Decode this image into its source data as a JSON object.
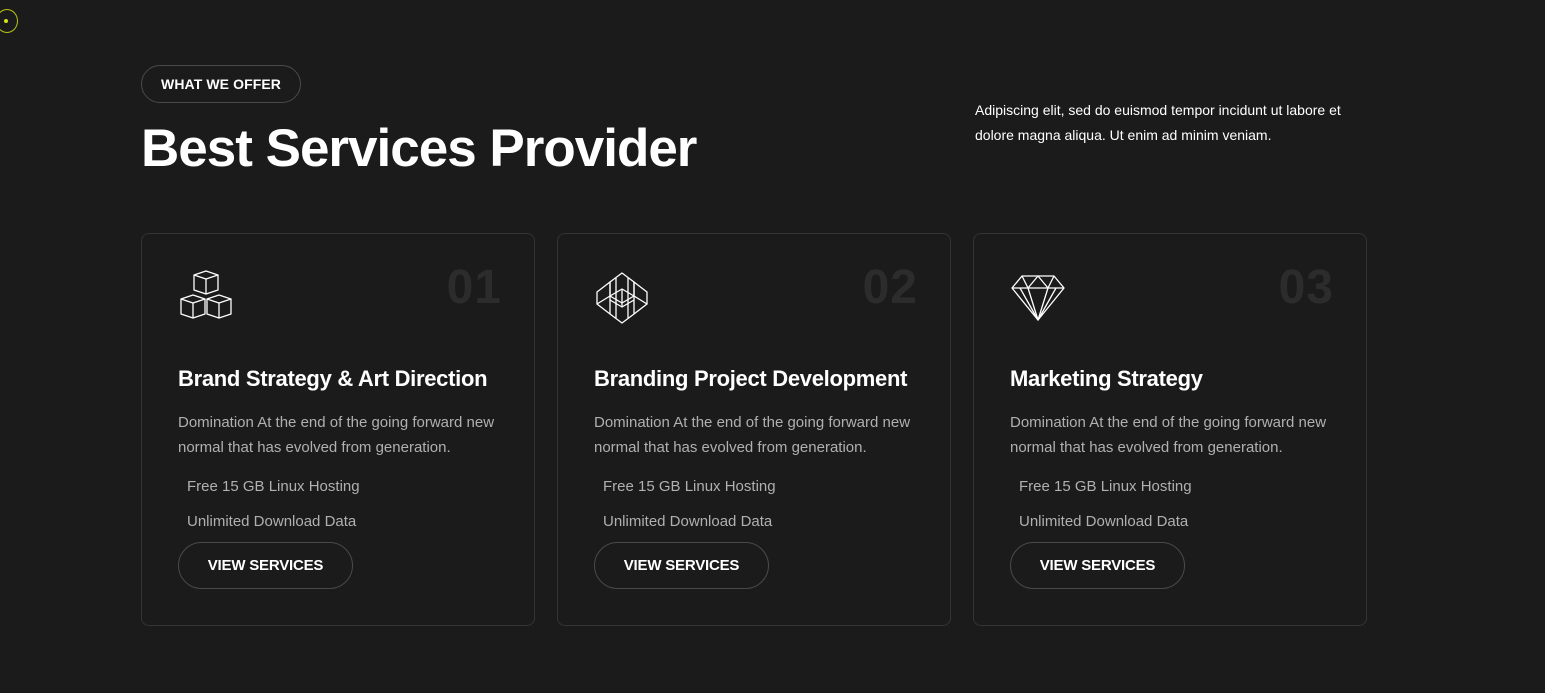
{
  "section": {
    "eyebrow": "WHAT WE OFFER",
    "title": "Best Services Provider",
    "lead": "Adipiscing elit, sed do euismod tempor incidunt ut labore et dolore magna aliqua. Ut enim ad minim veniam."
  },
  "cards": [
    {
      "number": "01",
      "icon": "cubes-icon",
      "title": "Brand Strategy & Art Direction",
      "description": "Domination At the end of the going forward new normal that has evolved from generation.",
      "features": [
        "Free 15 GB Linux Hosting",
        "Unlimited Download Data"
      ],
      "button": "VIEW SERVICES"
    },
    {
      "number": "02",
      "icon": "geometric-star-icon",
      "title": "Branding Project Development",
      "description": "Domination At the end of the going forward new normal that has evolved from generation.",
      "features": [
        "Free 15 GB Linux Hosting",
        "Unlimited Download Data"
      ],
      "button": "VIEW SERVICES"
    },
    {
      "number": "03",
      "icon": "diamond-icon",
      "title": "Marketing Strategy",
      "description": "Domination At the end of the going forward new normal that has evolved from generation.",
      "features": [
        "Free 15 GB Linux Hosting",
        "Unlimited Download Data"
      ],
      "button": "VIEW SERVICES"
    }
  ],
  "colors": {
    "background": "#1b1b1b",
    "card_border": "#343434",
    "muted_text": "#b0b0b0",
    "number_text": "#2c2c2c",
    "cursor_accent": "#d4e21a"
  }
}
